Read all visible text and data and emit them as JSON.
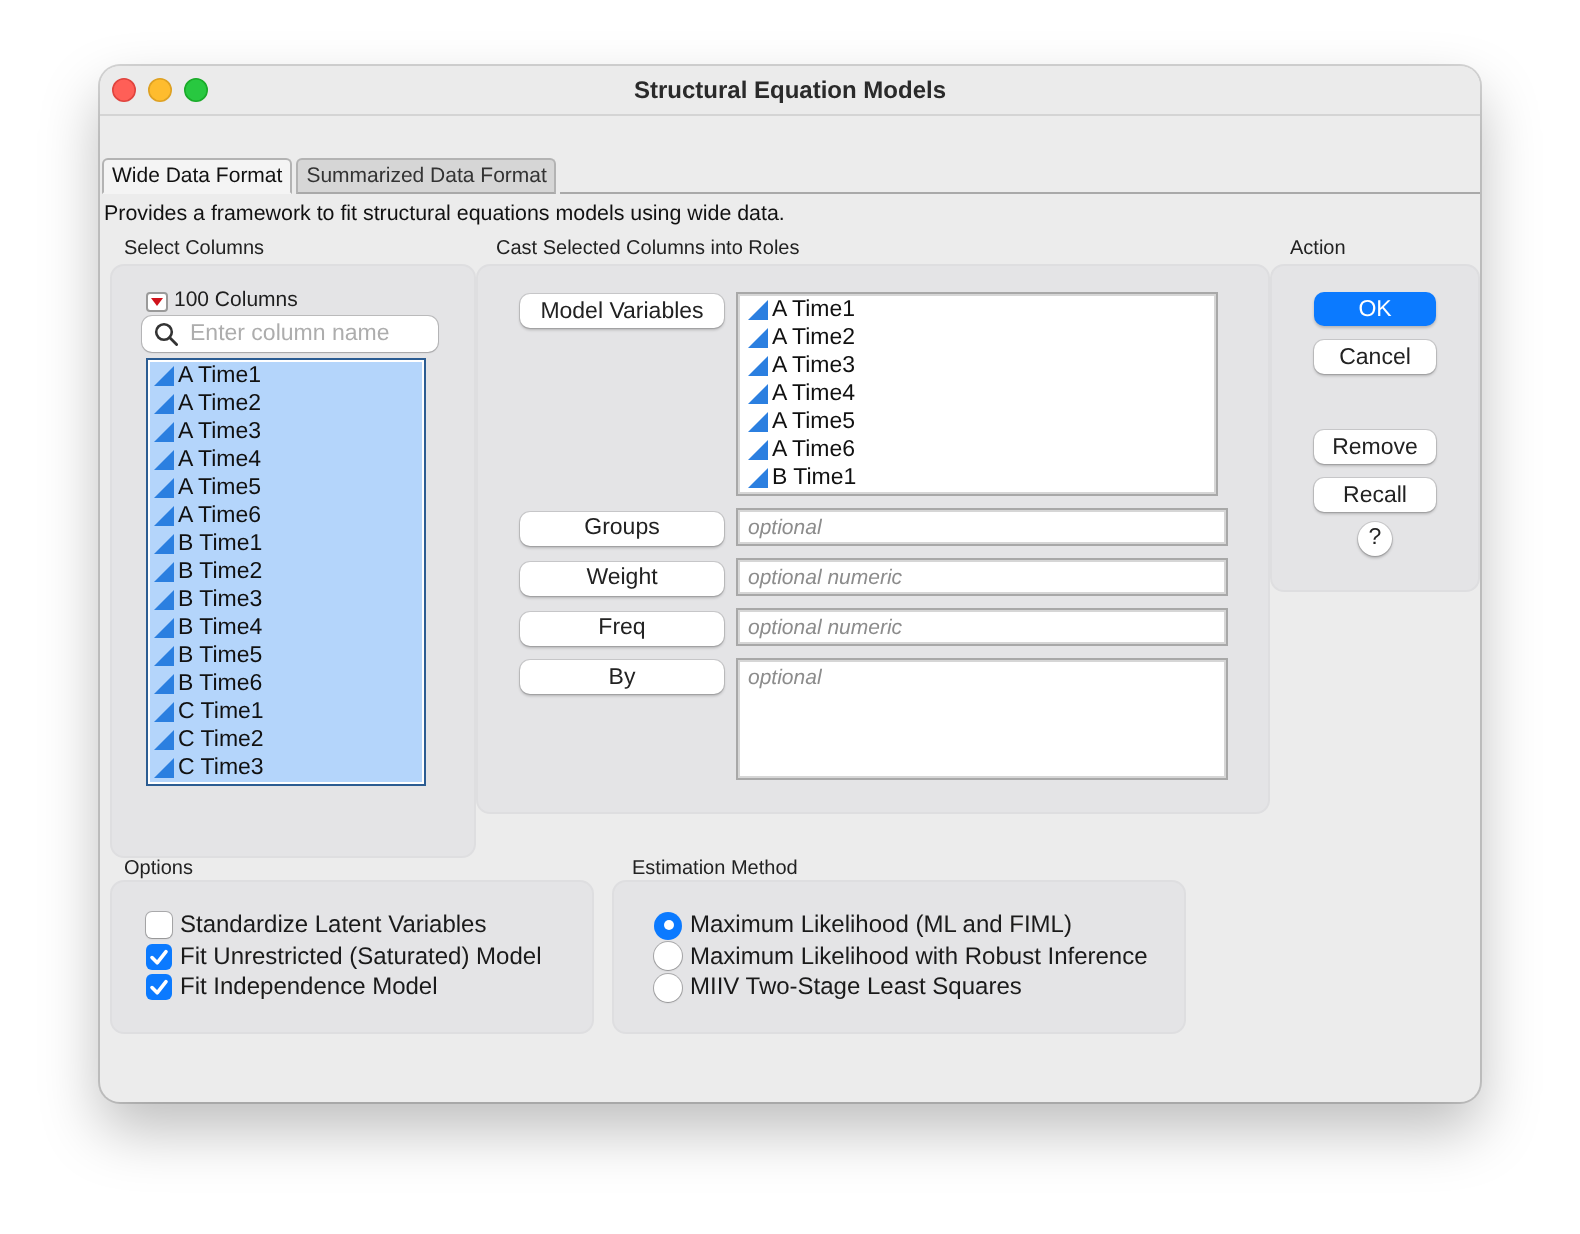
{
  "window": {
    "title": "Structural Equation Models"
  },
  "tabs": [
    {
      "label": "Wide Data Format",
      "selected": true
    },
    {
      "label": "Summarized Data Format",
      "selected": false
    }
  ],
  "description": "Provides a framework to fit structural equations models using wide data.",
  "select_columns": {
    "heading": "Select Columns",
    "count": "100 Columns",
    "search": {
      "placeholder": "Enter column name"
    },
    "columns": [
      {
        "name": "A Time1",
        "selected": true
      },
      {
        "name": "A Time2",
        "selected": true
      },
      {
        "name": "A Time3",
        "selected": true
      },
      {
        "name": "A Time4",
        "selected": true
      },
      {
        "name": "A Time5",
        "selected": true
      },
      {
        "name": "A Time6",
        "selected": true
      },
      {
        "name": "B Time1",
        "selected": true
      },
      {
        "name": "B Time2",
        "selected": true
      },
      {
        "name": "B Time3",
        "selected": true
      },
      {
        "name": "B Time4",
        "selected": true
      },
      {
        "name": "B Time5",
        "selected": true
      },
      {
        "name": "B Time6",
        "selected": true
      },
      {
        "name": "C Time1",
        "selected": true
      },
      {
        "name": "C Time2",
        "selected": true
      },
      {
        "name": "C Time3",
        "selected": true
      }
    ]
  },
  "roles": {
    "heading": "Cast Selected Columns into Roles",
    "rows": [
      {
        "label": "Model Variables",
        "kind": "list",
        "items": [
          "A Time1",
          "A Time2",
          "A Time3",
          "A Time4",
          "A Time5",
          "A Time6",
          "B Time1"
        ]
      },
      {
        "label": "Groups",
        "kind": "field",
        "placeholder": "optional"
      },
      {
        "label": "Weight",
        "kind": "field",
        "placeholder": "optional numeric"
      },
      {
        "label": "Freq",
        "kind": "field",
        "placeholder": "optional numeric"
      },
      {
        "label": "By",
        "kind": "area",
        "placeholder": "optional"
      }
    ]
  },
  "action": {
    "heading": "Action",
    "groups": [
      [
        {
          "label": "OK",
          "kind": "default"
        },
        {
          "label": "Cancel",
          "kind": "normal"
        }
      ],
      [
        {
          "label": "Remove",
          "kind": "normal"
        },
        {
          "label": "Recall",
          "kind": "normal"
        },
        {
          "label": "?",
          "kind": "help"
        }
      ]
    ]
  },
  "options": {
    "heading": "Options",
    "items": [
      {
        "label": "Standardize Latent Variables",
        "checked": false
      },
      {
        "label": "Fit Unrestricted (Saturated) Model",
        "checked": true
      },
      {
        "label": "Fit Independence Model",
        "checked": true
      }
    ]
  },
  "estimation_method": {
    "heading": "Estimation Method",
    "items": [
      {
        "label": "Maximum Likelihood (ML and FIML)",
        "selected": true
      },
      {
        "label": "Maximum Likelihood with Robust Inference",
        "selected": false
      },
      {
        "label": "MIIV Two-Stage Least Squares",
        "selected": false
      }
    ]
  }
}
